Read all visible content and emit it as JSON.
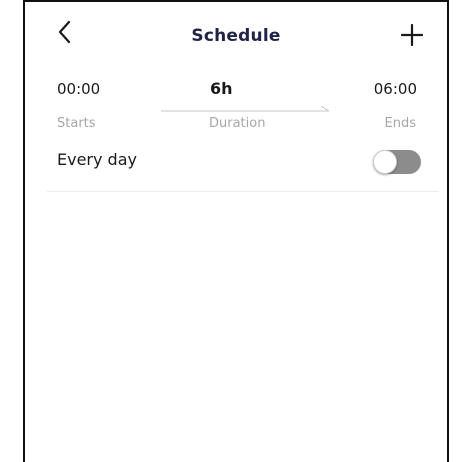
{
  "header": {
    "title": "Schedule",
    "back_icon": "chevron-left-icon",
    "add_icon": "plus-icon"
  },
  "time": {
    "start": "00:00",
    "start_label": "Starts",
    "duration": "6h",
    "duration_label": "Duration",
    "end": "06:00",
    "end_label": "Ends"
  },
  "repeat": {
    "label": "Every day",
    "enabled": false
  },
  "colors": {
    "title": "#1f2346",
    "muted_label": "#a7a7a7",
    "toggle_off": "#8c8c8c",
    "divider": "#ececec"
  }
}
